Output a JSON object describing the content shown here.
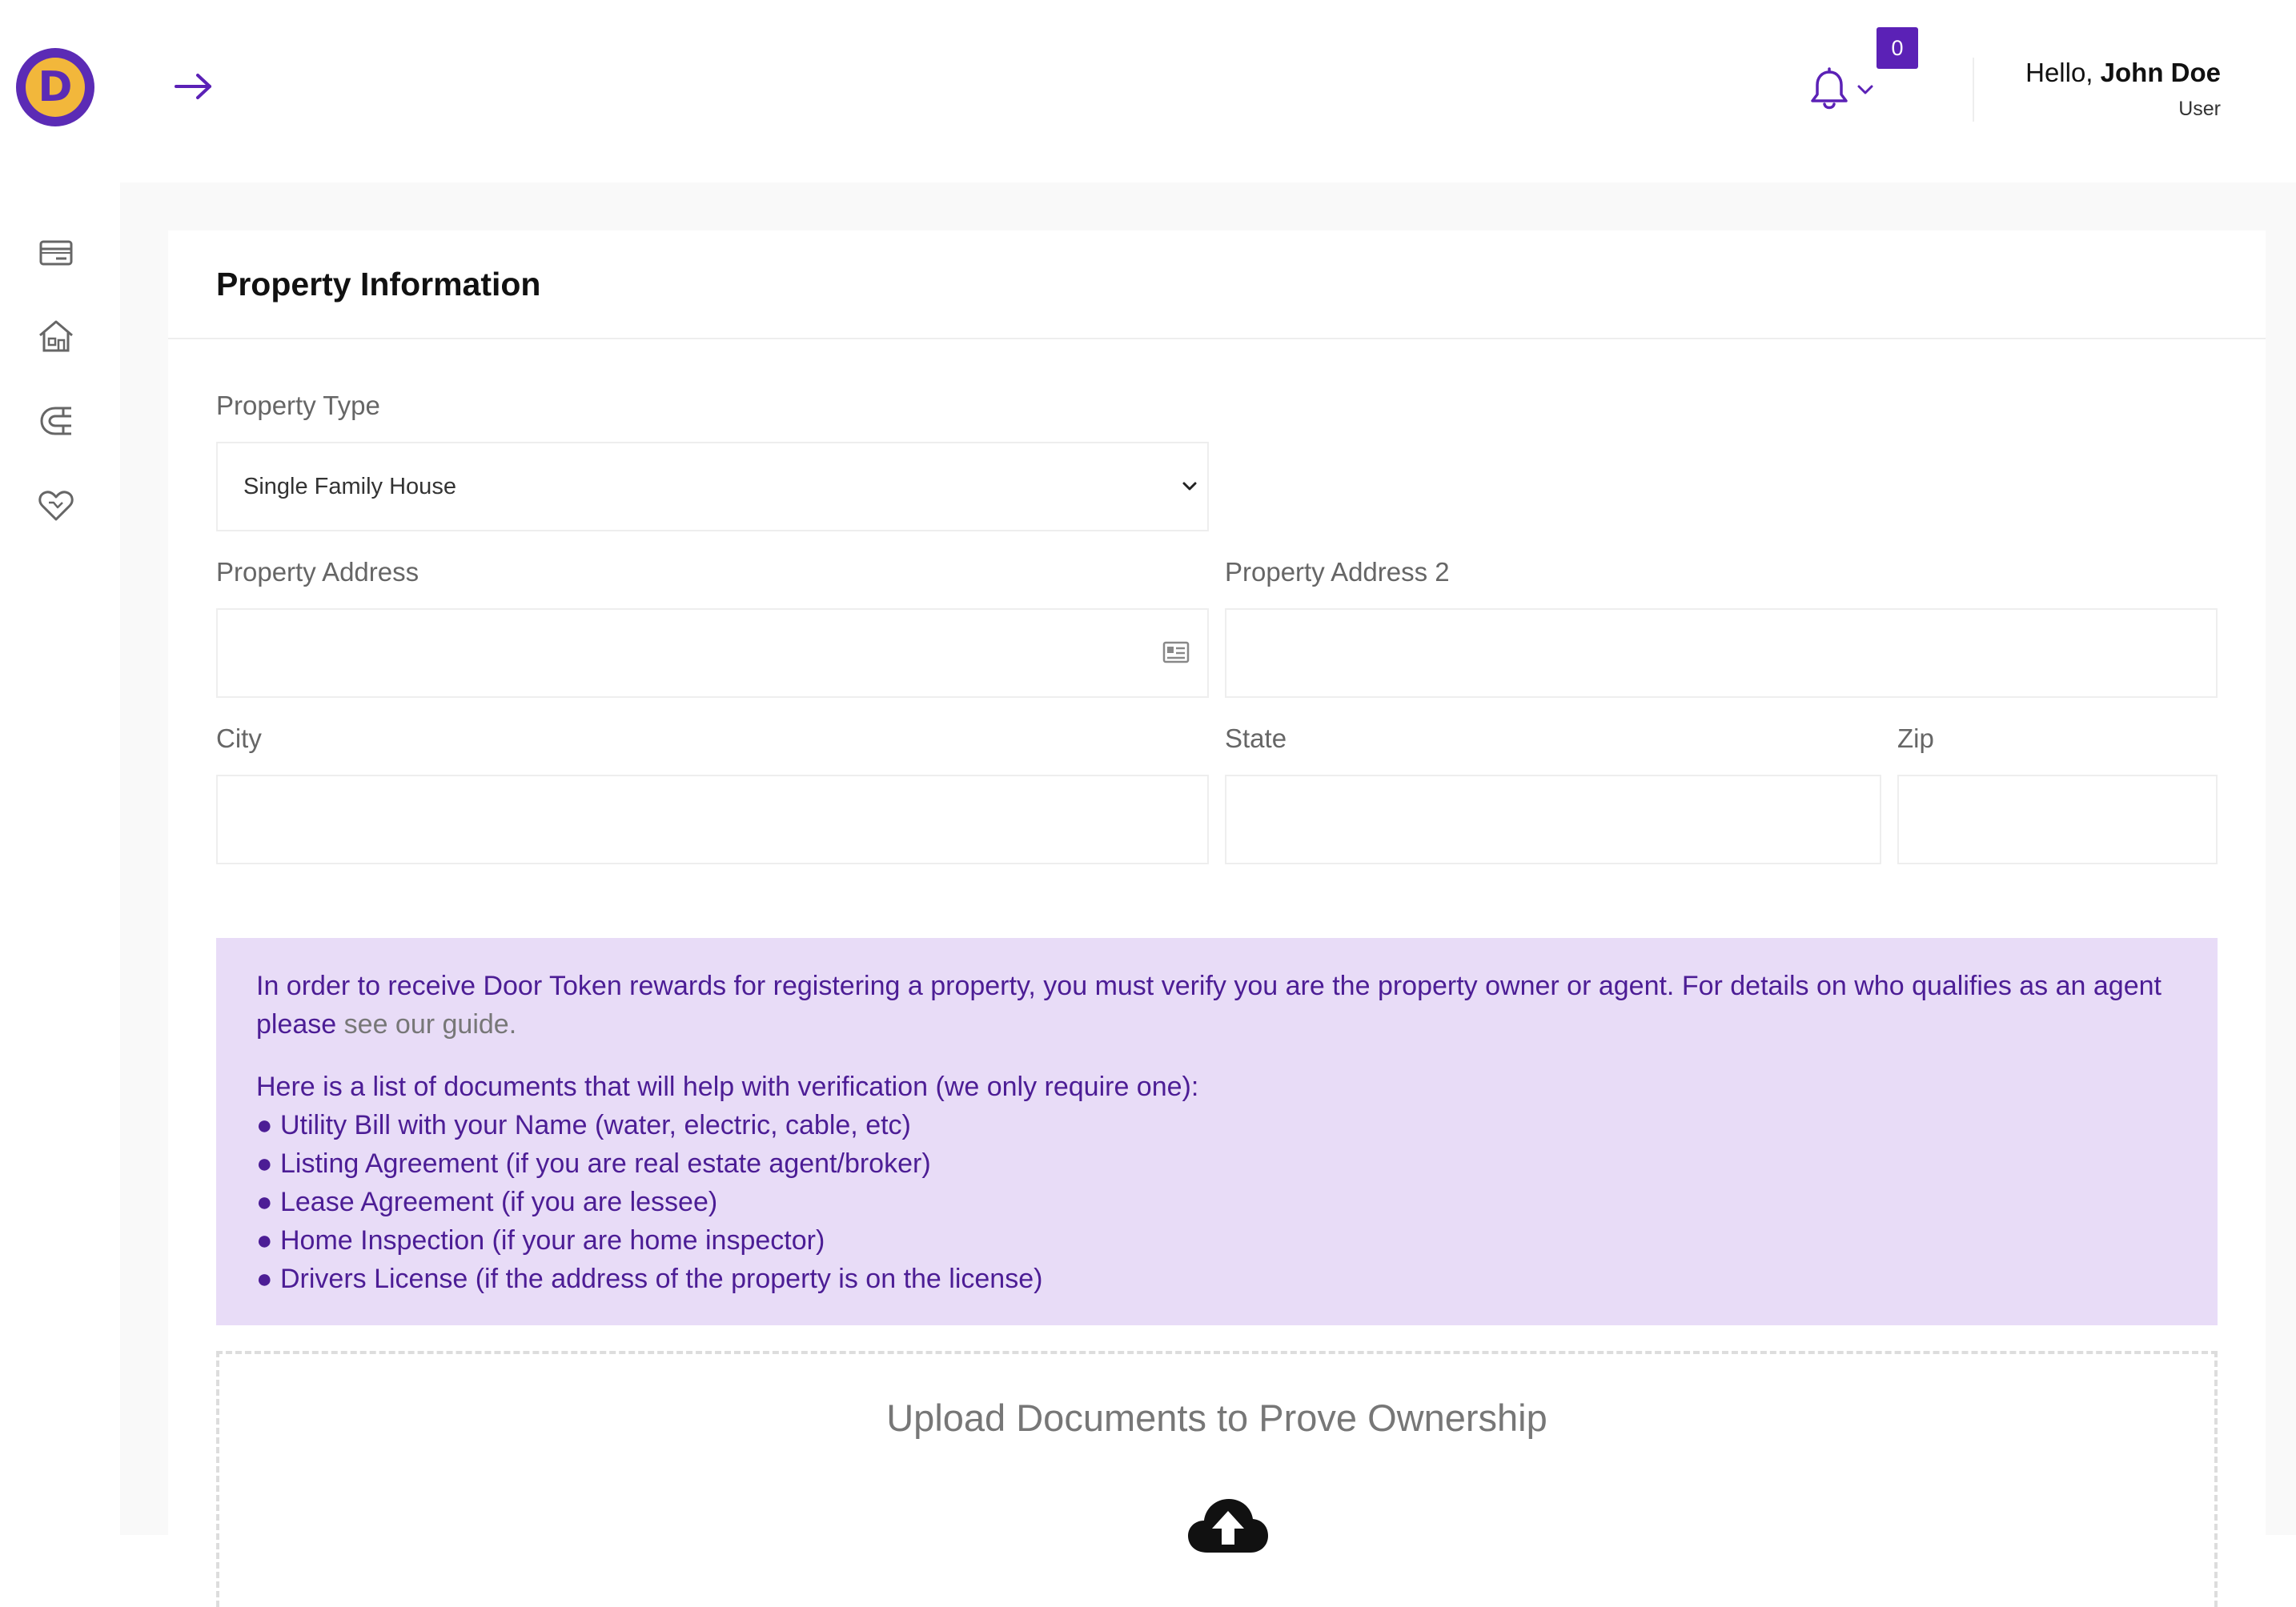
{
  "header": {
    "logo_letter": "D",
    "notification_count": "0",
    "greeting": "Hello,",
    "user_name": "John Doe",
    "user_role": "User"
  },
  "sidebar": {
    "items": [
      {
        "icon": "card-icon"
      },
      {
        "icon": "home-icon"
      },
      {
        "icon": "magnet-icon"
      },
      {
        "icon": "heart-icon"
      }
    ]
  },
  "card": {
    "title": "Property Information"
  },
  "form": {
    "property_type_label": "Property Type",
    "property_type_value": "Single Family House",
    "address_label": "Property Address",
    "address_value": "",
    "address2_label": "Property Address 2",
    "address2_value": "",
    "city_label": "City",
    "city_value": "",
    "state_label": "State",
    "state_value": "",
    "zip_label": "Zip",
    "zip_value": ""
  },
  "info": {
    "intro": "In order to receive Door Token rewards for registering a property, you must verify you are the property owner or agent. For details on who qualifies as an agent please",
    "guide_link": "see our guide.",
    "list_heading": "Here is a list of documents that will help with verification (we only require one):",
    "documents": [
      "● Utility Bill with your Name (water, electric, cable, etc)",
      "● Listing Agreement (if you are real estate agent/broker)",
      "● Lease Agreement (if you are lessee)",
      "● Home Inspection (if your are home inspector)",
      "● Drivers License (if the address of the property is on the license)"
    ]
  },
  "upload": {
    "title": "Upload Documents to Prove Ownership"
  },
  "colors": {
    "accent": "#5b21b6",
    "info_bg": "#e8dcf7",
    "info_text": "#4c1d95",
    "logo_gold": "#f2b73b"
  }
}
